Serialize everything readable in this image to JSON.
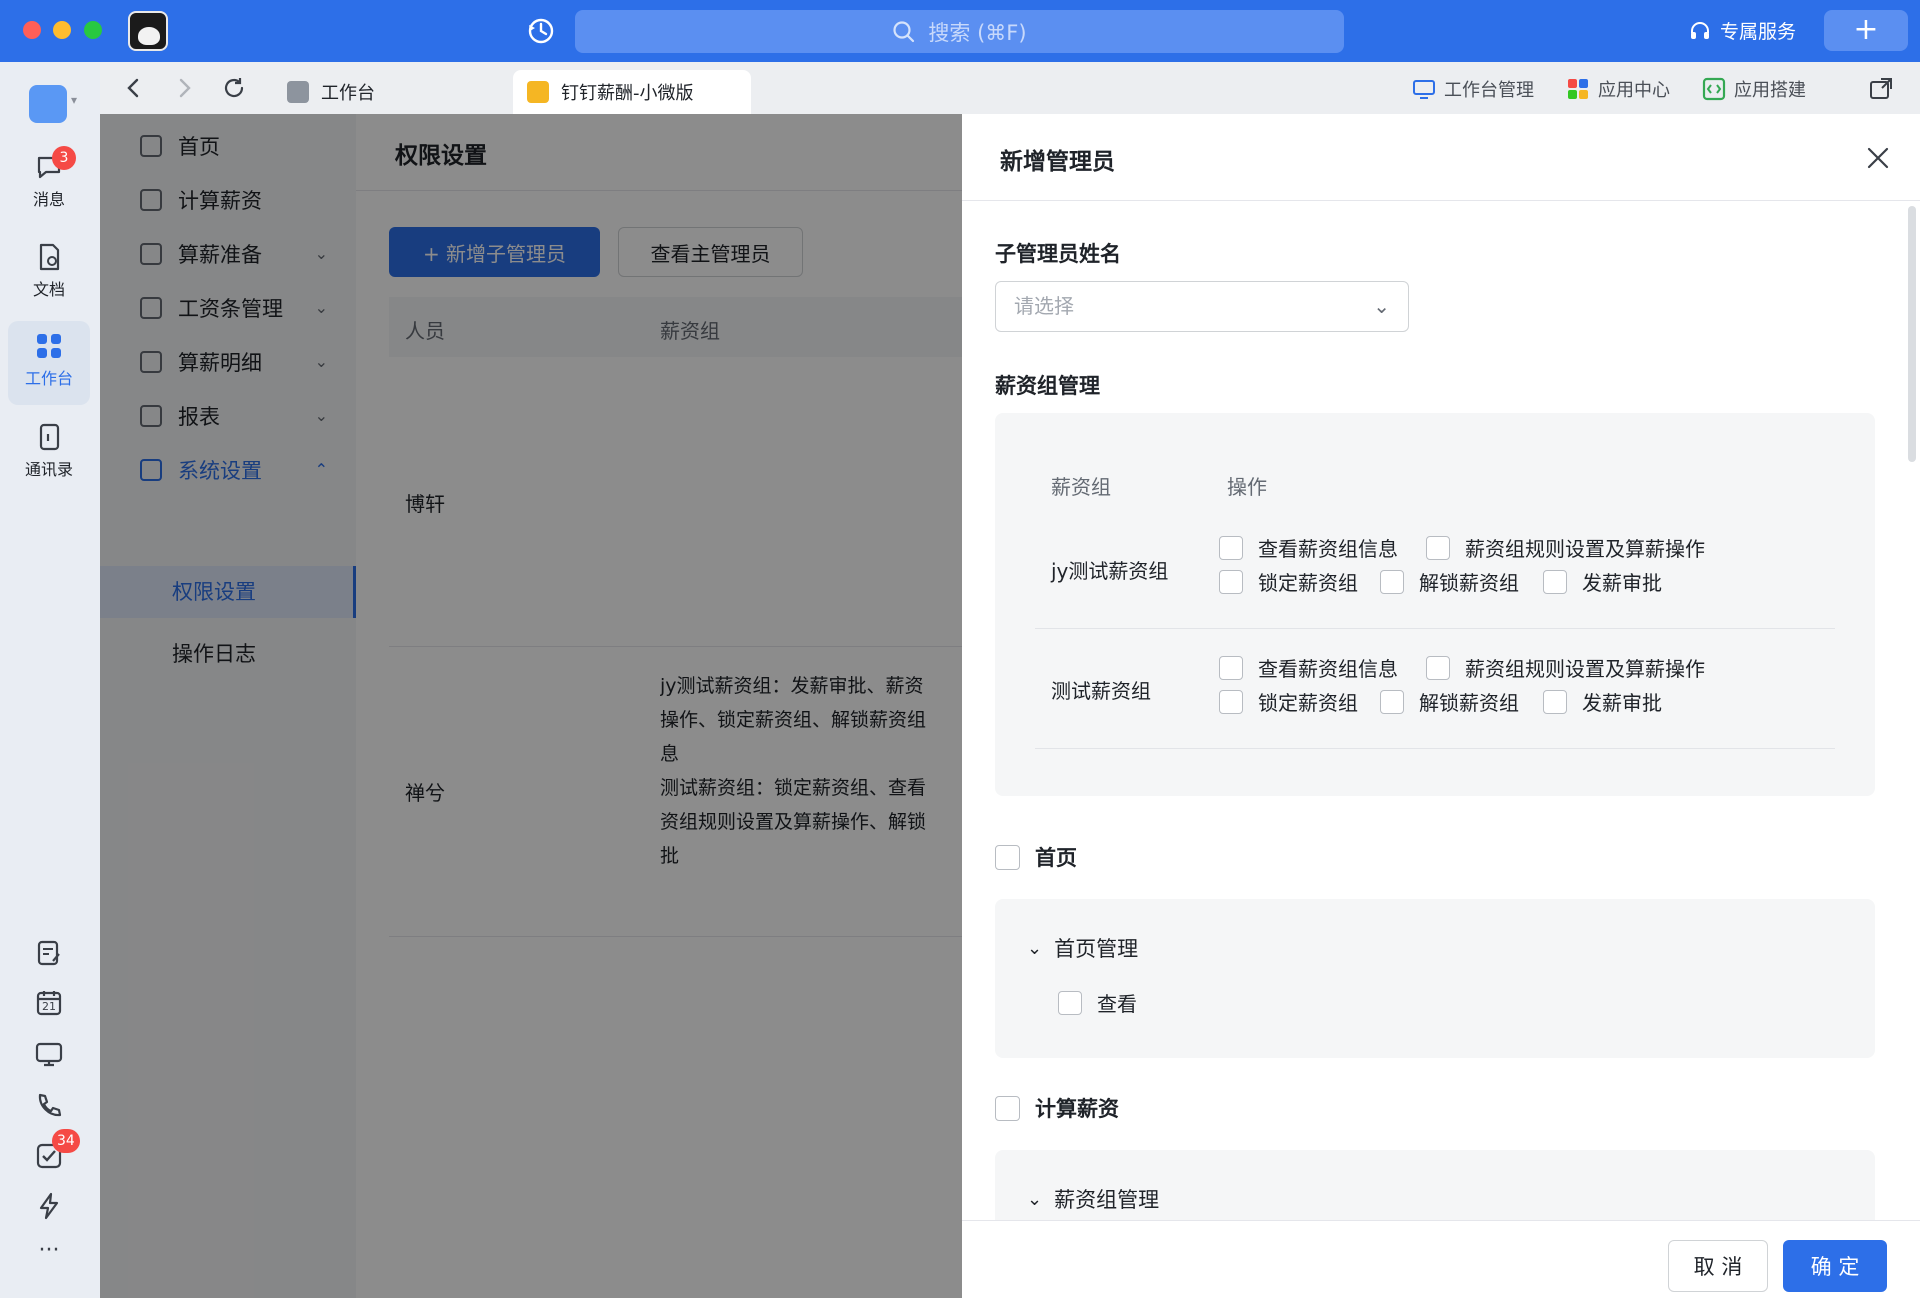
{
  "titlebar": {
    "search_placeholder": "搜索 (⌘F)",
    "service": "专属服务",
    "plus": "+"
  },
  "appbar": {
    "messages": {
      "label": "消息",
      "badge": "3"
    },
    "docs": {
      "label": "文档"
    },
    "workbench": {
      "label": "工作台"
    },
    "contacts": {
      "label": "通讯录"
    },
    "calendar_day": "21",
    "todo_badge": "34",
    "more": "···"
  },
  "tabs": [
    {
      "label": "工作台"
    },
    {
      "label": "钉钉薪酬-小微版"
    }
  ],
  "tabbar_right": {
    "workbench_mgmt": "工作台管理",
    "app_center": "应用中心",
    "app_build": "应用搭建"
  },
  "sidenav": {
    "items": [
      {
        "label": "首页"
      },
      {
        "label": "计算薪资"
      },
      {
        "label": "算薪准备"
      },
      {
        "label": "工资条管理"
      },
      {
        "label": "算薪明细"
      },
      {
        "label": "报表"
      },
      {
        "label": "系统设置"
      }
    ],
    "subitems": [
      {
        "label": "权限设置"
      },
      {
        "label": "操作日志"
      }
    ]
  },
  "main": {
    "title": "权限设置",
    "add_sub_admin": "+ 新增子管理员",
    "view_main_admin": "查看主管理员",
    "columns": [
      "人员",
      "薪资组"
    ],
    "rows": [
      {
        "name": "博轩",
        "desc": ""
      },
      {
        "name": "禅兮",
        "desc": "jy测试薪资组：发薪审批、薪资\n操作、锁定薪资组、解锁薪资组\n息\n测试薪资组：锁定薪资组、查看\n资组规则设置及算薪操作、解锁\n批"
      }
    ]
  },
  "drawer": {
    "title": "新增管理员",
    "name_label": "子管理员姓名",
    "name_placeholder": "请选择",
    "salary_mgmt_label": "薪资组管理",
    "group_header": "薪资组",
    "ops_header": "操作",
    "groups": [
      {
        "name": "jy测试薪资组",
        "ops": [
          "查看薪资组信息",
          "薪资组规则设置及算薪操作",
          "锁定薪资组",
          "解锁薪资组",
          "发薪审批"
        ]
      },
      {
        "name": "测试薪资组",
        "ops": [
          "查看薪资组信息",
          "薪资组规则设置及算薪操作",
          "锁定薪资组",
          "解锁薪资组",
          "发薪审批"
        ]
      }
    ],
    "section_home": "首页",
    "home_sub": "首页管理",
    "home_view": "查看",
    "section_calc": "计算薪资",
    "calc_sub": "薪资组管理",
    "cancel": "取 消",
    "confirm": "确 定"
  }
}
